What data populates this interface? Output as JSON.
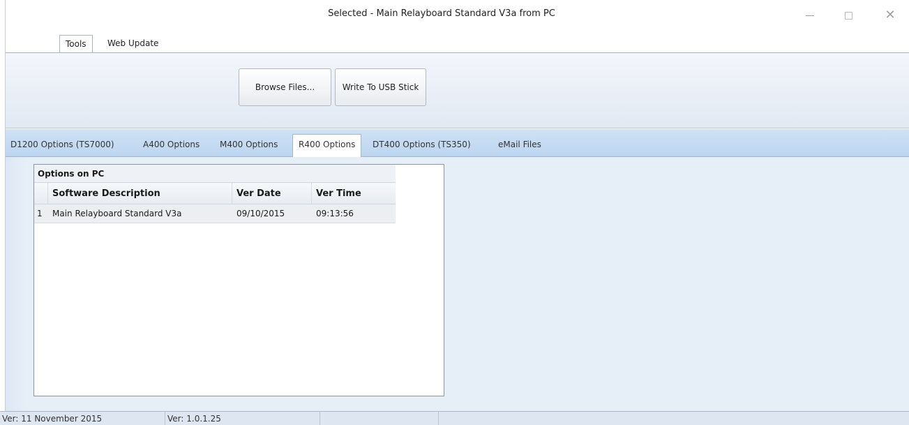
{
  "window": {
    "title": "Selected - Main Relayboard Standard V3a from PC"
  },
  "ribbon": {
    "tabs": [
      {
        "label": "Tools",
        "active": true
      },
      {
        "label": "Web Update",
        "active": false
      }
    ],
    "buttons": {
      "browse_label": "Browse Files...",
      "write_label": "Write To USB Stick"
    }
  },
  "doc_tabs": [
    {
      "label": "D1200 Options (TS7000)",
      "active": false
    },
    {
      "label": "A400 Options",
      "active": false
    },
    {
      "label": "M400 Options",
      "active": false
    },
    {
      "label": "R400 Options",
      "active": true
    },
    {
      "label": "DT400 Options (TS350)",
      "active": false
    },
    {
      "label": "eMail Files",
      "active": false
    }
  ],
  "grid": {
    "group_title": "Options on PC",
    "columns": {
      "description": "Software Description",
      "date": "Ver Date",
      "time": "Ver Time"
    },
    "rows": [
      {
        "index": "1",
        "description": "Main Relayboard Standard V3a",
        "date": "09/10/2015",
        "time": "09:13:56"
      }
    ]
  },
  "status": {
    "left": "Ver: 11 November 2015",
    "middle": "Ver: 1.0.1.25",
    "right": ""
  },
  "colors": {
    "tab_strip": "#c6dbf2",
    "content_bg": "#e6eef8",
    "status_bg": "#dde6f1"
  }
}
